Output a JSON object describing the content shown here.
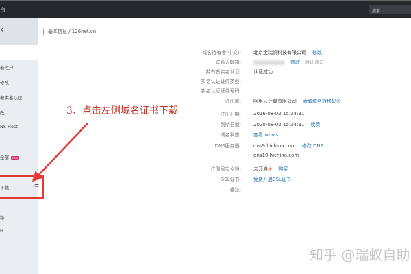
{
  "topbar": {
    "title": "台",
    "search_placeholder": "搜索"
  },
  "sidebar": {
    "back": "‹",
    "items": [
      {
        "label": "者过户"
      },
      {
        "label": "修改"
      },
      {
        "label": "者实名认证"
      },
      {
        "label": "改"
      },
      {
        "label": "NS Host"
      },
      {
        "label": "全部",
        "badge": "new"
      },
      {
        "label": "下载",
        "highlighted": true
      },
      {
        "label": "移"
      },
      {
        "label": "H"
      }
    ]
  },
  "breadcrumb": "基本信息 / 126net.cn",
  "details": [
    {
      "label": "域名持有者(中文):",
      "value": "北京金瑞帆科技有限公司",
      "links": [
        "修改"
      ]
    },
    {
      "label": "联系人邮箱:",
      "value": "",
      "blurred": true,
      "links": [
        "修改"
      ],
      "muted": "验证通过"
    },
    {
      "label": "持有者实名认证:",
      "value": "认证成功"
    },
    {
      "label": "实名认证证件类型:",
      "value": ""
    },
    {
      "label": "实名认证证件号码:",
      "value": ""
    },
    {
      "label": "注册商:",
      "value": "阿里云计算有限公司",
      "links": [
        "索取域名转移码⑦"
      ]
    },
    {
      "label": "注册日期:",
      "value": "2016-08-02 15:34:31"
    },
    {
      "label": "到期日期:",
      "value": "2020-08-02 15:34:31",
      "links": [
        "续费"
      ]
    },
    {
      "label": "域名状态:",
      "value": "",
      "links": [
        "查看 whois"
      ]
    },
    {
      "label": "DNS服务器:",
      "value": "dns9.hichina.com",
      "links": [
        "修改 DNS"
      ]
    },
    {
      "label": "",
      "value": "dns10.hichina.com"
    },
    {
      "label": "注册局安全锁:",
      "value": "未开启",
      "warn": "⑦",
      "links": [
        "购买"
      ]
    },
    {
      "label": "SSL证书:",
      "value": "",
      "links": [
        "免费开启SSL证书"
      ]
    },
    {
      "label": "备注:",
      "value": ""
    }
  ],
  "annotation": "3、点击左侧域名证书下载",
  "watermark": "知乎 @瑞蚁自助",
  "colors": {
    "accent": "#1d6fb8",
    "annotation": "#c0392b",
    "highlight_box": "#e53935",
    "topbar": "#25282c"
  }
}
